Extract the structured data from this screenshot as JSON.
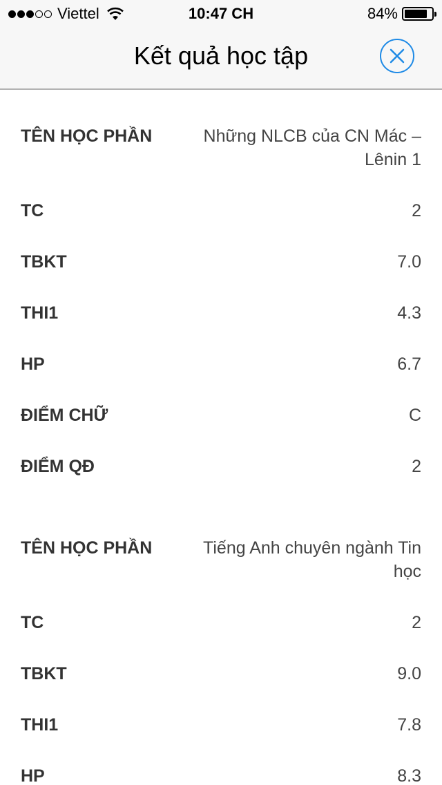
{
  "status_bar": {
    "signal_dots_filled": 3,
    "signal_dots_total": 5,
    "carrier": "Viettel",
    "time": "10:47 CH",
    "battery_percent": "84%",
    "battery_level": 0.84
  },
  "nav": {
    "title": "Kết quả học tập",
    "close_icon": "close-circle-icon",
    "accent_color": "#1e8ae6"
  },
  "records": [
    {
      "rows": [
        {
          "label": "TÊN HỌC PHẦN",
          "value": "Những NLCB của CN Mác – Lênin 1"
        },
        {
          "label": "TC",
          "value": "2"
        },
        {
          "label": "TBKT",
          "value": "7.0"
        },
        {
          "label": "THI1",
          "value": "4.3"
        },
        {
          "label": "HP",
          "value": "6.7"
        },
        {
          "label": "ĐIỂM CHỮ",
          "value": "C"
        },
        {
          "label": "ĐIỂM QĐ",
          "value": "2"
        }
      ]
    },
    {
      "rows": [
        {
          "label": "TÊN HỌC PHẦN",
          "value": "Tiếng Anh chuyên ngành Tin học"
        },
        {
          "label": "TC",
          "value": "2"
        },
        {
          "label": "TBKT",
          "value": "9.0"
        },
        {
          "label": "THI1",
          "value": "7.8"
        },
        {
          "label": "HP",
          "value": "8.3"
        }
      ]
    }
  ]
}
